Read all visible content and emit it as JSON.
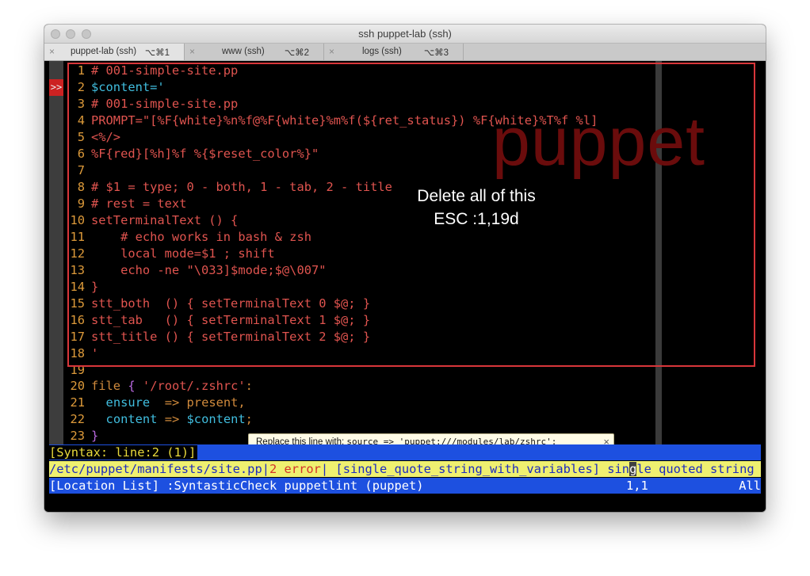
{
  "window": {
    "title": "ssh puppet-lab (ssh)"
  },
  "tabs": [
    {
      "label": "puppet-lab (ssh)",
      "shortcut": "⌥⌘1",
      "active": true
    },
    {
      "label": "www (ssh)",
      "shortcut": "⌥⌘2",
      "active": false
    },
    {
      "label": "logs (ssh)",
      "shortcut": "⌥⌘3",
      "active": false
    }
  ],
  "icons": {
    "tab_close": "×",
    "tooltip_close": "×",
    "traffic_lights": "window-control-icon"
  },
  "editor": {
    "sign": ">>",
    "lines": [
      {
        "n": "1",
        "t": "# 001-simple-site.pp",
        "color": "#e0544f"
      },
      {
        "n": "2",
        "t": "$content='",
        "color": "#40bdde"
      },
      {
        "n": "3",
        "t": "# 001-simple-site.pp",
        "color": "#e0544f"
      },
      {
        "n": "4",
        "t": "PROMPT=\"[%F{white}%n%f@%F{white}%m%f(${ret_status}) %F{white}%T%f %l]",
        "color": "#e0544f"
      },
      {
        "n": "5",
        "t": "<%/>",
        "color": "#e0544f"
      },
      {
        "n": "6",
        "t": "%F{red}[%h]%f %{$reset_color%}\"",
        "color": "#e0544f"
      },
      {
        "n": "7",
        "t": "",
        "color": "#e0544f"
      },
      {
        "n": "8",
        "t": "# $1 = type; 0 - both, 1 - tab, 2 - title",
        "color": "#e0544f"
      },
      {
        "n": "9",
        "t": "# rest = text",
        "color": "#e0544f"
      },
      {
        "n": "10",
        "t": "setTerminalText () {",
        "color": "#e0544f"
      },
      {
        "n": "11",
        "t": "    # echo works in bash & zsh",
        "color": "#e0544f"
      },
      {
        "n": "12",
        "t": "    local mode=$1 ; shift",
        "color": "#e0544f"
      },
      {
        "n": "13",
        "t": "    echo -ne \"\\033]$mode;$@\\007\"",
        "color": "#e0544f"
      },
      {
        "n": "14",
        "t": "}",
        "color": "#e0544f"
      },
      {
        "n": "15",
        "t": "stt_both  () { setTerminalText 0 $@; }",
        "color": "#e0544f"
      },
      {
        "n": "16",
        "t": "stt_tab   () { setTerminalText 1 $@; }",
        "color": "#e0544f"
      },
      {
        "n": "17",
        "t": "stt_title () { setTerminalText 2 $@; }",
        "color": "#e0544f"
      },
      {
        "n": "18",
        "t": "'",
        "color": "#e0544f"
      },
      {
        "n": "19",
        "t": "",
        "color": "#e0544f"
      }
    ],
    "line20": {
      "n": "20",
      "kw": "file",
      "brace": "{",
      "str": "'/root/.zshrc'",
      "colon": ":"
    },
    "line21": {
      "n": "21",
      "attr": "ensure",
      "arrow": "=>",
      "val": "present",
      "comma": ","
    },
    "line22": {
      "n": "22",
      "attr": "content",
      "arrow": "=>",
      "val": "$content",
      "semi": ";"
    },
    "line23": {
      "n": "23",
      "t": "}"
    }
  },
  "overlay": {
    "watermark": "puppet",
    "note_line1": "Delete all of this",
    "note_line2": "ESC :1,19d"
  },
  "tooltip": {
    "label": "Replace this line with: ",
    "code": "source => 'puppet:///modules/lab/zshrc';"
  },
  "statusbar": {
    "syntax": "[Syntax: line:2 (1)]",
    "cmd_path": "/etc/puppet/manifests/site.pp",
    "cmd_sep1": "|",
    "cmd_err": "2 error",
    "cmd_sep2": "|",
    "cmd_msg": " [single_quote_string_with_variables] sin",
    "cmd_cursor": "g",
    "cmd_tail": "le quoted string",
    "loc_left": "[Location List] :SyntasticCheck puppetlint (puppet)",
    "loc_pos": "1,1",
    "loc_all": "All"
  },
  "colors": {
    "accent_red": "#d8363a",
    "status_blue": "#1d50e0",
    "cmd_yellow": "#eff070",
    "line_number": "#dd9a3a"
  }
}
